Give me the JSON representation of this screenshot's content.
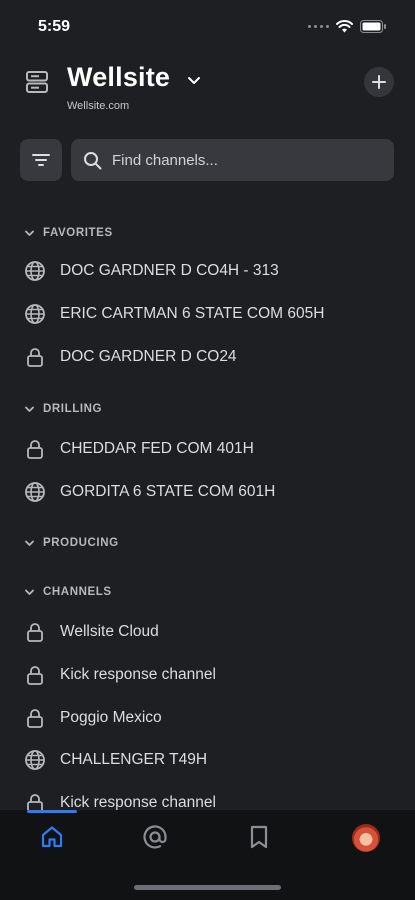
{
  "status": {
    "time": "5:59"
  },
  "header": {
    "team_name": "Wellsite",
    "team_url": "Wellsite.com",
    "server_icon": "server-icon",
    "chevron_icon": "chevron-down-icon",
    "add_icon": "plus-icon"
  },
  "search": {
    "placeholder": "Find channels..."
  },
  "sections": {
    "favorites": "FAVORITES",
    "drilling": "DRILLING",
    "producing": "PRODUCING",
    "channels": "CHANNELS"
  },
  "favorites": [
    {
      "label": "DOC GARDNER D CO4H - 313",
      "icon": "globe-icon"
    },
    {
      "label": "ERIC CARTMAN 6 STATE COM 605H",
      "icon": "globe-icon"
    },
    {
      "label": "DOC GARDNER D CO24",
      "icon": "lock-icon"
    }
  ],
  "drilling": [
    {
      "label": "CHEDDAR FED COM 401H",
      "icon": "lock-icon"
    },
    {
      "label": "GORDITA 6 STATE COM 601H",
      "icon": "globe-icon"
    }
  ],
  "channels": [
    {
      "label": "Wellsite Cloud",
      "icon": "lock-icon"
    },
    {
      "label": "Kick response channel",
      "icon": "lock-icon"
    },
    {
      "label": "Poggio Mexico",
      "icon": "lock-icon"
    },
    {
      "label": "CHALLENGER T49H",
      "icon": "globe-icon"
    },
    {
      "label": "Kick response channel",
      "icon": "lock-icon"
    }
  ],
  "tabs": [
    "home-icon",
    "mentions-icon",
    "saved-icon",
    "account-avatar"
  ],
  "colors": {
    "background": "#1e1f22",
    "accent": "#2f7bf5",
    "tab_bar": "#111214"
  }
}
